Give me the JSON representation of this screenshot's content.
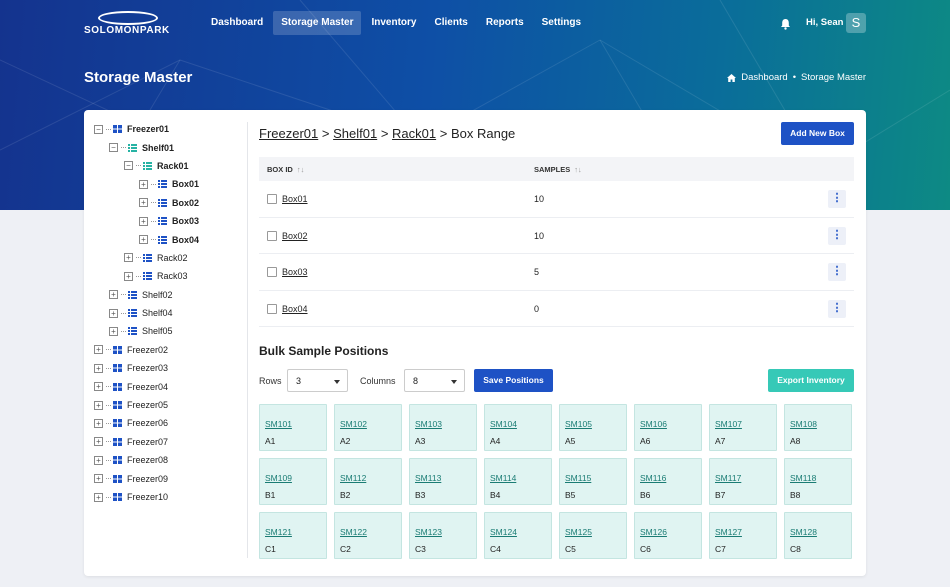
{
  "app": {
    "logo_text": "SOLOMONPARK"
  },
  "nav": {
    "items": [
      {
        "label": "Dashboard",
        "active": false
      },
      {
        "label": "Storage Master",
        "active": true
      },
      {
        "label": "Inventory",
        "active": false
      },
      {
        "label": "Clients",
        "active": false
      },
      {
        "label": "Reports",
        "active": false
      },
      {
        "label": "Settings",
        "active": false
      }
    ],
    "greeting": "Hi, Sean",
    "avatar_initial": "S"
  },
  "page": {
    "title": "Storage Master",
    "breadcrumb": {
      "home": "Dashboard",
      "separator": "•",
      "current": "Storage Master"
    }
  },
  "tree": {
    "nodes": [
      {
        "label": "Freezer01",
        "level": 0,
        "expanded": true,
        "selected": true,
        "icon": "grid-icon"
      },
      {
        "label": "Shelf01",
        "level": 1,
        "expanded": true,
        "selected": true,
        "icon": "shelf-icon"
      },
      {
        "label": "Rack01",
        "level": 2,
        "expanded": true,
        "selected": true,
        "icon": "rack-icon"
      },
      {
        "label": "Box01",
        "level": 3,
        "expanded": false,
        "selected": true,
        "icon": "box-icon"
      },
      {
        "label": "Box02",
        "level": 3,
        "expanded": false,
        "selected": true,
        "icon": "box-icon"
      },
      {
        "label": "Box03",
        "level": 3,
        "expanded": false,
        "selected": true,
        "icon": "box-icon"
      },
      {
        "label": "Box04",
        "level": 3,
        "expanded": false,
        "selected": true,
        "icon": "box-icon"
      },
      {
        "label": "Rack02",
        "level": 2,
        "expanded": false,
        "selected": false,
        "icon": "rack-icon"
      },
      {
        "label": "Rack03",
        "level": 2,
        "expanded": false,
        "selected": false,
        "icon": "rack-icon"
      },
      {
        "label": "Shelf02",
        "level": 1,
        "expanded": false,
        "selected": false,
        "icon": "shelf-icon"
      },
      {
        "label": "Shelf04",
        "level": 1,
        "expanded": false,
        "selected": false,
        "icon": "shelf-icon"
      },
      {
        "label": "Shelf05",
        "level": 1,
        "expanded": false,
        "selected": false,
        "icon": "shelf-icon"
      },
      {
        "label": "Freezer02",
        "level": 0,
        "expanded": false,
        "selected": false,
        "icon": "grid-icon"
      },
      {
        "label": "Freezer03",
        "level": 0,
        "expanded": false,
        "selected": false,
        "icon": "grid-icon"
      },
      {
        "label": "Freezer04",
        "level": 0,
        "expanded": false,
        "selected": false,
        "icon": "grid-icon"
      },
      {
        "label": "Freezer05",
        "level": 0,
        "expanded": false,
        "selected": false,
        "icon": "grid-icon"
      },
      {
        "label": "Freezer06",
        "level": 0,
        "expanded": false,
        "selected": false,
        "icon": "grid-icon"
      },
      {
        "label": "Freezer07",
        "level": 0,
        "expanded": false,
        "selected": false,
        "icon": "grid-icon"
      },
      {
        "label": "Freezer08",
        "level": 0,
        "expanded": false,
        "selected": false,
        "icon": "grid-icon"
      },
      {
        "label": "Freezer09",
        "level": 0,
        "expanded": false,
        "selected": false,
        "icon": "grid-icon"
      },
      {
        "label": "Freezer10",
        "level": 0,
        "expanded": false,
        "selected": false,
        "icon": "grid-icon"
      }
    ]
  },
  "content": {
    "path": {
      "parts": [
        "Freezer01",
        "Shelf01",
        "Rack01"
      ],
      "separator": ">",
      "suffix": "Box Range"
    },
    "add_button": "Add New Box",
    "table": {
      "headers": [
        "BOX ID",
        "SAMPLES"
      ],
      "rows": [
        {
          "box_id": "Box01",
          "samples": "10"
        },
        {
          "box_id": "Box02",
          "samples": "10"
        },
        {
          "box_id": "Box03",
          "samples": "5"
        },
        {
          "box_id": "Box04",
          "samples": "0"
        }
      ]
    },
    "bulk": {
      "title": "Bulk Sample Positions",
      "rows_label": "Rows",
      "rows_value": "3",
      "columns_label": "Columns",
      "columns_value": "8",
      "save_button": "Save Positions",
      "export_button": "Export Inventory",
      "cells": [
        [
          {
            "code": "SM101",
            "pos": "A1"
          },
          {
            "code": "SM102",
            "pos": "A2"
          },
          {
            "code": "SM103",
            "pos": "A3"
          },
          {
            "code": "SM104",
            "pos": "A4"
          },
          {
            "code": "SM105",
            "pos": "A5"
          },
          {
            "code": "SM106",
            "pos": "A6"
          },
          {
            "code": "SM107",
            "pos": "A7"
          },
          {
            "code": "SM108",
            "pos": "A8"
          }
        ],
        [
          {
            "code": "SM109",
            "pos": "B1"
          },
          {
            "code": "SM112",
            "pos": "B2"
          },
          {
            "code": "SM113",
            "pos": "B3"
          },
          {
            "code": "SM114",
            "pos": "B4"
          },
          {
            "code": "SM115",
            "pos": "B5"
          },
          {
            "code": "SM116",
            "pos": "B6"
          },
          {
            "code": "SM117",
            "pos": "B7"
          },
          {
            "code": "SM118",
            "pos": "B8"
          }
        ],
        [
          {
            "code": "SM121",
            "pos": "C1"
          },
          {
            "code": "SM122",
            "pos": "C2"
          },
          {
            "code": "SM123",
            "pos": "C3"
          },
          {
            "code": "SM124",
            "pos": "C4"
          },
          {
            "code": "SM125",
            "pos": "C5"
          },
          {
            "code": "SM126",
            "pos": "C6"
          },
          {
            "code": "SM127",
            "pos": "C7"
          },
          {
            "code": "SM128",
            "pos": "C8"
          }
        ]
      ]
    }
  },
  "colors": {
    "primary": "#1e52c5",
    "teal": "#36c9b7",
    "tree_icon": "#1e52c5",
    "tree_icon_teal": "#27b3a4"
  }
}
